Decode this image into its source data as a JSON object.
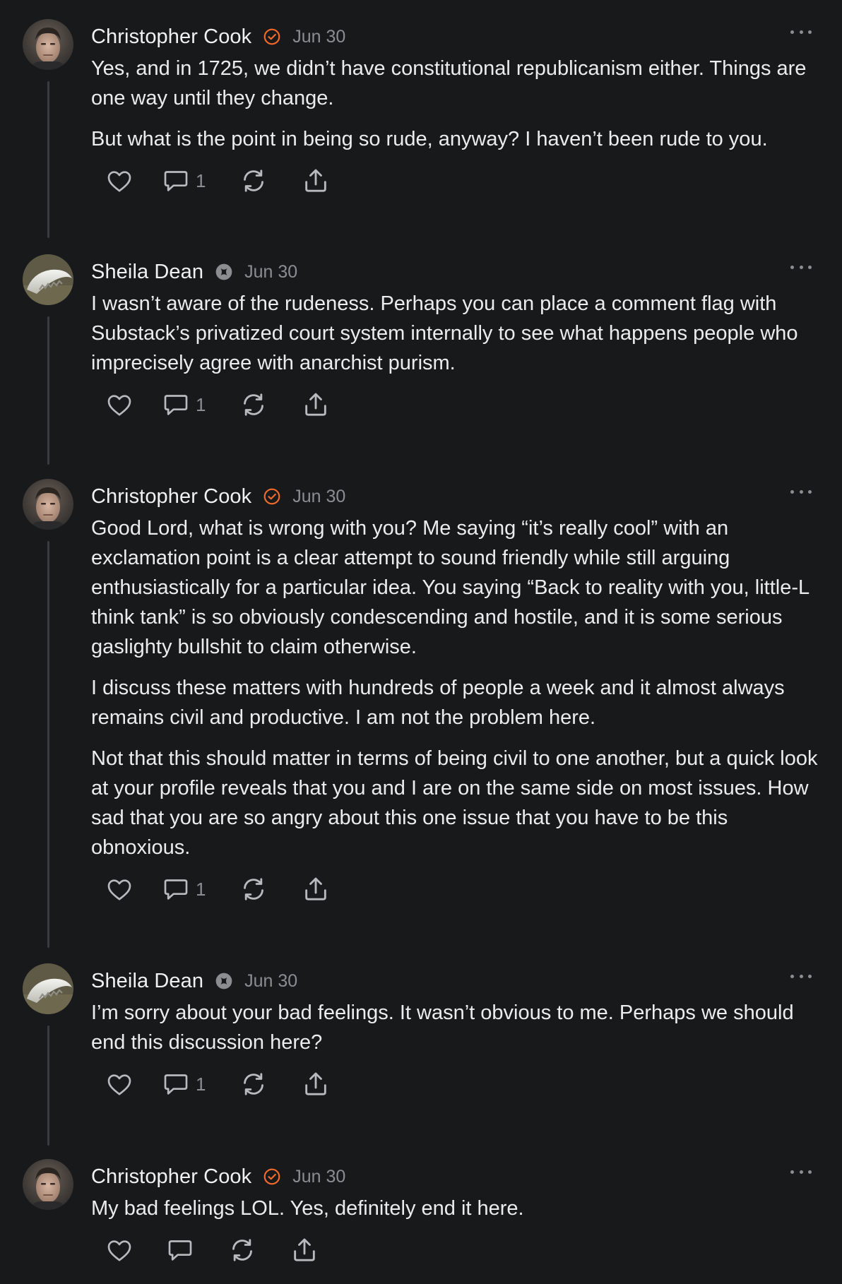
{
  "colors": {
    "background": "#18191b",
    "text": "#ececed",
    "muted": "#8c8d91",
    "verified_badge": "#f26a2c",
    "thread_line": "#3a3b3e"
  },
  "comments": [
    {
      "author": "Christopher Cook",
      "badge": "verified-check-icon",
      "date": "Jun 30",
      "paragraphs": [
        "Yes, and in 1725, we didn’t have constitutional republicanism either. Things are one way until they change.",
        "But what is the point in being so rude, anyway? I haven’t been rude to you."
      ],
      "reply_count": "1"
    },
    {
      "author": "Sheila Dean",
      "badge": "subscriber-badge-icon",
      "date": "Jun 30",
      "paragraphs": [
        "I wasn’t aware of the rudeness. Perhaps you can place a comment flag with Substack’s privatized court system internally to see what happens people who imprecisely agree with anarchist purism."
      ],
      "reply_count": "1"
    },
    {
      "author": "Christopher Cook",
      "badge": "verified-check-icon",
      "date": "Jun 30",
      "paragraphs": [
        "Good Lord, what is wrong with you? Me saying “it’s really cool” with an exclamation point is a clear attempt to sound friendly while still arguing enthusiastically for a particular idea. You saying “Back to reality with you, little-L think tank” is so obviously condescending and hostile, and it is some serious gaslighty bullshit to claim otherwise.",
        "I discuss these matters with hundreds of people a week and it almost always remains civil and productive. I am not the problem here.",
        "Not that this should matter in terms of being civil to one another, but a quick look at your profile reveals that you and I are on the same side on most issues. How sad that you are so angry about this one issue that you have to be this obnoxious."
      ],
      "reply_count": "1"
    },
    {
      "author": "Sheila Dean",
      "badge": "subscriber-badge-icon",
      "date": "Jun 30",
      "paragraphs": [
        "I’m sorry about your bad feelings. It wasn’t obvious to me. Perhaps we should end this discussion here?"
      ],
      "reply_count": "1"
    },
    {
      "author": "Christopher Cook",
      "badge": "verified-check-icon",
      "date": "Jun 30",
      "paragraphs": [
        "My bad feelings LOL. Yes, definitely end it here."
      ],
      "reply_count": ""
    }
  ]
}
